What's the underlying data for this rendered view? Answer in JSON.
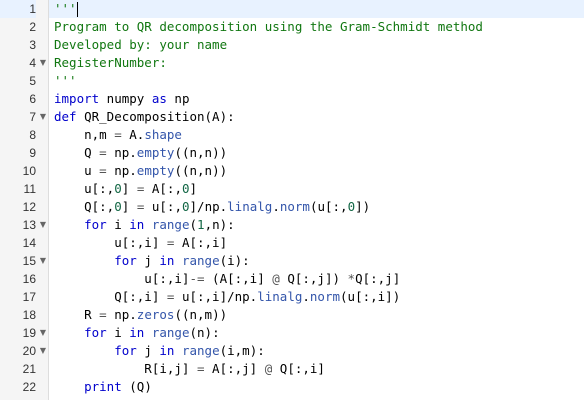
{
  "editor": {
    "lines": [
      {
        "num": "1",
        "fold": false,
        "active": true,
        "cursor": true,
        "tokens": [
          [
            "comment",
            "'''"
          ]
        ]
      },
      {
        "num": "2",
        "fold": false,
        "tokens": [
          [
            "comment",
            "Program to QR decomposition using the Gram-Schmidt method"
          ]
        ]
      },
      {
        "num": "3",
        "fold": false,
        "tokens": [
          [
            "comment",
            "Developed by: your name"
          ]
        ]
      },
      {
        "num": "4",
        "fold": true,
        "tokens": [
          [
            "comment",
            "RegisterNumber:"
          ]
        ]
      },
      {
        "num": "5",
        "fold": false,
        "tokens": [
          [
            "comment",
            "'''"
          ]
        ]
      },
      {
        "num": "6",
        "fold": false,
        "tokens": [
          [
            "kw",
            "import"
          ],
          [
            "plain",
            " numpy "
          ],
          [
            "kw",
            "as"
          ],
          [
            "plain",
            " np"
          ]
        ]
      },
      {
        "num": "7",
        "fold": true,
        "tokens": [
          [
            "kw",
            "def"
          ],
          [
            "plain",
            " QR_Decomposition(A):"
          ]
        ]
      },
      {
        "num": "8",
        "fold": false,
        "tokens": [
          [
            "plain",
            "    n,m "
          ],
          [
            "op",
            "="
          ],
          [
            "plain",
            " A."
          ],
          [
            "fn",
            "shape"
          ]
        ]
      },
      {
        "num": "9",
        "fold": false,
        "tokens": [
          [
            "plain",
            "    Q "
          ],
          [
            "op",
            "="
          ],
          [
            "plain",
            " np."
          ],
          [
            "fn",
            "empty"
          ],
          [
            "plain",
            "((n,n))"
          ]
        ]
      },
      {
        "num": "10",
        "fold": false,
        "tokens": [
          [
            "plain",
            "    u "
          ],
          [
            "op",
            "="
          ],
          [
            "plain",
            " np."
          ],
          [
            "fn",
            "empty"
          ],
          [
            "plain",
            "((n,n))"
          ]
        ]
      },
      {
        "num": "11",
        "fold": false,
        "tokens": [
          [
            "plain",
            "    u[:,"
          ],
          [
            "num",
            "0"
          ],
          [
            "plain",
            "] "
          ],
          [
            "op",
            "="
          ],
          [
            "plain",
            " A[:,"
          ],
          [
            "num",
            "0"
          ],
          [
            "plain",
            "]"
          ]
        ]
      },
      {
        "num": "12",
        "fold": false,
        "tokens": [
          [
            "plain",
            "    Q[:,"
          ],
          [
            "num",
            "0"
          ],
          [
            "plain",
            "] "
          ],
          [
            "op",
            "="
          ],
          [
            "plain",
            " u[:,"
          ],
          [
            "num",
            "0"
          ],
          [
            "plain",
            "]/np."
          ],
          [
            "fn",
            "linalg"
          ],
          [
            "plain",
            "."
          ],
          [
            "fn",
            "norm"
          ],
          [
            "plain",
            "(u[:,"
          ],
          [
            "num",
            "0"
          ],
          [
            "plain",
            "])"
          ]
        ]
      },
      {
        "num": "13",
        "fold": true,
        "tokens": [
          [
            "plain",
            "    "
          ],
          [
            "kw",
            "for"
          ],
          [
            "plain",
            " i "
          ],
          [
            "kw",
            "in"
          ],
          [
            "plain",
            " "
          ],
          [
            "fn",
            "range"
          ],
          [
            "plain",
            "("
          ],
          [
            "num",
            "1"
          ],
          [
            "plain",
            ",n):"
          ]
        ]
      },
      {
        "num": "14",
        "fold": false,
        "tokens": [
          [
            "plain",
            "        u[:,i] "
          ],
          [
            "op",
            "="
          ],
          [
            "plain",
            " A[:,i]"
          ]
        ]
      },
      {
        "num": "15",
        "fold": true,
        "tokens": [
          [
            "plain",
            "        "
          ],
          [
            "kw",
            "for"
          ],
          [
            "plain",
            " j "
          ],
          [
            "kw",
            "in"
          ],
          [
            "plain",
            " "
          ],
          [
            "fn",
            "range"
          ],
          [
            "plain",
            "(i):"
          ]
        ]
      },
      {
        "num": "16",
        "fold": false,
        "tokens": [
          [
            "plain",
            "            u[:,i]"
          ],
          [
            "op",
            "-="
          ],
          [
            "plain",
            " (A[:,i] "
          ],
          [
            "op",
            "@"
          ],
          [
            "plain",
            " Q[:,j]) "
          ],
          [
            "op",
            "*"
          ],
          [
            "plain",
            "Q[:,j]"
          ]
        ]
      },
      {
        "num": "17",
        "fold": false,
        "tokens": [
          [
            "plain",
            "        Q[:,i] "
          ],
          [
            "op",
            "="
          ],
          [
            "plain",
            " u[:,i]/np."
          ],
          [
            "fn",
            "linalg"
          ],
          [
            "plain",
            "."
          ],
          [
            "fn",
            "norm"
          ],
          [
            "plain",
            "(u[:,i])"
          ]
        ]
      },
      {
        "num": "18",
        "fold": false,
        "tokens": [
          [
            "plain",
            "    R "
          ],
          [
            "op",
            "="
          ],
          [
            "plain",
            " np."
          ],
          [
            "fn",
            "zeros"
          ],
          [
            "plain",
            "((n,m))"
          ]
        ]
      },
      {
        "num": "19",
        "fold": true,
        "tokens": [
          [
            "plain",
            "    "
          ],
          [
            "kw",
            "for"
          ],
          [
            "plain",
            " i "
          ],
          [
            "kw",
            "in"
          ],
          [
            "plain",
            " "
          ],
          [
            "fn",
            "range"
          ],
          [
            "plain",
            "(n):"
          ]
        ]
      },
      {
        "num": "20",
        "fold": true,
        "tokens": [
          [
            "plain",
            "        "
          ],
          [
            "kw",
            "for"
          ],
          [
            "plain",
            " j "
          ],
          [
            "kw",
            "in"
          ],
          [
            "plain",
            " "
          ],
          [
            "fn",
            "range"
          ],
          [
            "plain",
            "(i,m):"
          ]
        ]
      },
      {
        "num": "21",
        "fold": false,
        "tokens": [
          [
            "plain",
            "            R[i,j] "
          ],
          [
            "op",
            "="
          ],
          [
            "plain",
            " A[:,j] "
          ],
          [
            "op",
            "@"
          ],
          [
            "plain",
            " Q[:,i]"
          ]
        ]
      },
      {
        "num": "22",
        "fold": false,
        "tokens": [
          [
            "plain",
            "    "
          ],
          [
            "kw",
            "print"
          ],
          [
            "plain",
            " (Q)"
          ]
        ]
      }
    ]
  }
}
